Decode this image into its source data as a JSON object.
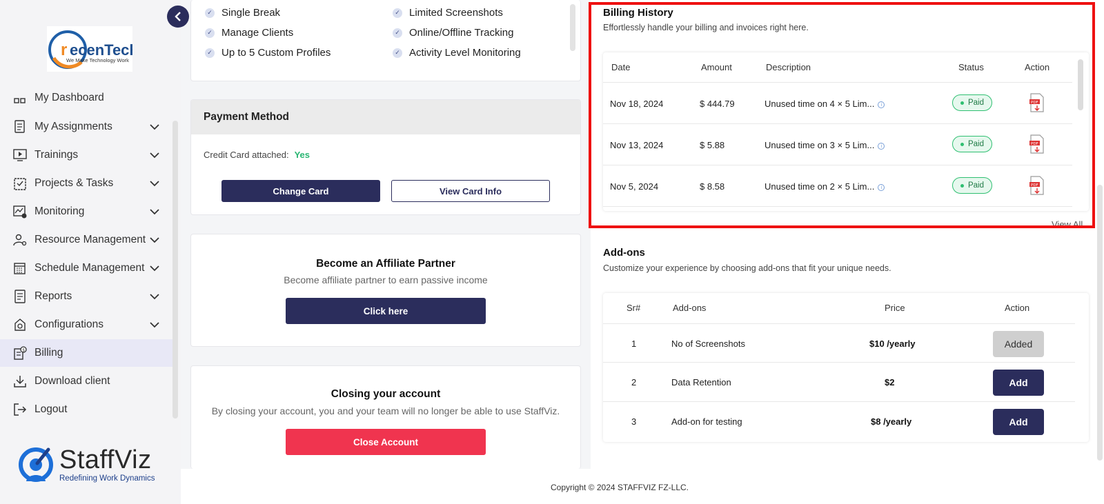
{
  "sidebar": {
    "logo": {
      "brand": "recenTech",
      "tagline": "We Make Technology Work"
    },
    "collapse_icon": "chevron-left-icon",
    "items": [
      {
        "label": "My Dashboard",
        "icon": "dashboard-icon",
        "has_chevron": false
      },
      {
        "label": "My Assignments",
        "icon": "assignments-icon",
        "has_chevron": true
      },
      {
        "label": "Trainings",
        "icon": "play-screen-icon",
        "has_chevron": true
      },
      {
        "label": "Projects & Tasks",
        "icon": "clipboard-icon",
        "has_chevron": true
      },
      {
        "label": "Monitoring",
        "icon": "monitoring-icon",
        "has_chevron": true
      },
      {
        "label": "Resource Management",
        "icon": "resource-icon",
        "has_chevron": true
      },
      {
        "label": "Schedule Management",
        "icon": "calendar-icon",
        "has_chevron": true
      },
      {
        "label": "Reports",
        "icon": "report-icon",
        "has_chevron": true
      },
      {
        "label": "Configurations",
        "icon": "config-icon",
        "has_chevron": true
      },
      {
        "label": "Billing",
        "icon": "billing-icon",
        "has_chevron": false,
        "active": true
      },
      {
        "label": "Download client",
        "icon": "download-icon",
        "has_chevron": false
      },
      {
        "label": "Logout",
        "icon": "logout-icon",
        "has_chevron": false
      }
    ],
    "footer_brand": {
      "name": "StaffViz",
      "tagline": "Redefining Work Dynamics"
    }
  },
  "plan_features": {
    "left": [
      "Single Break",
      "Manage Clients",
      "Up to 5 Custom Profiles"
    ],
    "right": [
      "Limited Screenshots",
      "Online/Offline Tracking",
      "Activity Level Monitoring"
    ]
  },
  "payment": {
    "title": "Payment Method",
    "cc_label": "Credit Card attached:",
    "cc_value": "Yes",
    "change_card": "Change Card",
    "view_card": "View Card Info"
  },
  "affiliate": {
    "title": "Become an Affiliate Partner",
    "subtitle": "Become affiliate partner to earn passive income",
    "button": "Click here"
  },
  "closing": {
    "title": "Closing your account",
    "subtitle": "By closing your account, you and your team will no longer be able to use StaffViz.",
    "button": "Close Account"
  },
  "billing_history": {
    "title": "Billing History",
    "subtitle": "Effortlessly handle your billing and invoices right here.",
    "columns": [
      "Date",
      "Amount",
      "Description",
      "Status",
      "Action"
    ],
    "rows": [
      {
        "date": "Nov 18, 2024",
        "amount": "$ 444.79",
        "description": "Unused time on 4 × 5 Lim...",
        "status": "Paid"
      },
      {
        "date": "Nov 13, 2024",
        "amount": "$ 5.88",
        "description": "Unused time on 3 × 5 Lim...",
        "status": "Paid"
      },
      {
        "date": "Nov 5, 2024",
        "amount": "$ 8.58",
        "description": "Unused time on 2 × 5 Lim...",
        "status": "Paid"
      }
    ],
    "view_all": "View All",
    "highlight_color": "#ee1111"
  },
  "addons": {
    "title": "Add-ons",
    "subtitle": "Customize your experience by choosing add-ons that fit your unique needs.",
    "columns": [
      "Sr#",
      "Add-ons",
      "Price",
      "Action"
    ],
    "rows": [
      {
        "sr": "1",
        "name": "No of Screenshots",
        "price": "$10 /yearly",
        "action": "Added"
      },
      {
        "sr": "2",
        "name": "Data Retention",
        "price": "$2",
        "action": "Add"
      },
      {
        "sr": "3",
        "name": "Add-on for testing",
        "price": "$8 /yearly",
        "action": "Add"
      }
    ]
  },
  "footer": {
    "copyright": "Copyright © 2024 STAFFVIZ FZ-LLC."
  },
  "colors": {
    "primary": "#2b2d5c",
    "danger": "#f0344f",
    "success": "#2ab673"
  }
}
